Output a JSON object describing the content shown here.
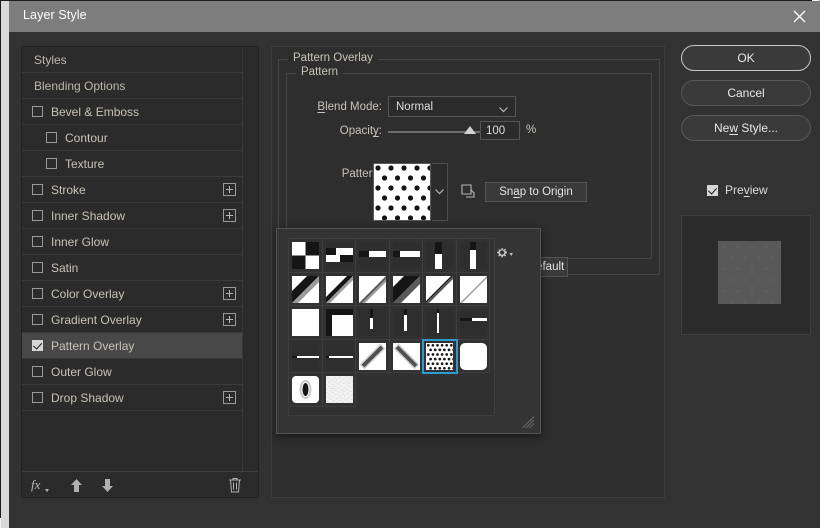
{
  "window": {
    "title": "Layer Style",
    "close_icon": "close-icon"
  },
  "styles_panel": {
    "rows": [
      {
        "label": "Styles",
        "type": "header",
        "checked": false,
        "plus": false,
        "selected": false
      },
      {
        "label": "Blending Options",
        "type": "header",
        "checked": false,
        "plus": false,
        "selected": false
      },
      {
        "label": "Bevel & Emboss",
        "type": "item",
        "checked": false,
        "plus": false,
        "selected": false
      },
      {
        "label": "Contour",
        "type": "sub",
        "checked": false,
        "plus": false,
        "selected": false
      },
      {
        "label": "Texture",
        "type": "sub",
        "checked": false,
        "plus": false,
        "selected": false
      },
      {
        "label": "Stroke",
        "type": "item",
        "checked": false,
        "plus": true,
        "selected": false
      },
      {
        "label": "Inner Shadow",
        "type": "item",
        "checked": false,
        "plus": true,
        "selected": false
      },
      {
        "label": "Inner Glow",
        "type": "item",
        "checked": false,
        "plus": false,
        "selected": false
      },
      {
        "label": "Satin",
        "type": "item",
        "checked": false,
        "plus": false,
        "selected": false
      },
      {
        "label": "Color Overlay",
        "type": "item",
        "checked": false,
        "plus": true,
        "selected": false
      },
      {
        "label": "Gradient Overlay",
        "type": "item",
        "checked": false,
        "plus": true,
        "selected": false
      },
      {
        "label": "Pattern Overlay",
        "type": "item",
        "checked": true,
        "plus": false,
        "selected": true
      },
      {
        "label": "Outer Glow",
        "type": "item",
        "checked": false,
        "plus": false,
        "selected": false
      },
      {
        "label": "Drop Shadow",
        "type": "item",
        "checked": false,
        "plus": true,
        "selected": false
      }
    ],
    "toolbar": {
      "fx_label": "fx",
      "fx_icon": "fx-menu-icon",
      "move_up_icon": "arrow-up-icon",
      "move_down_icon": "arrow-down-icon",
      "delete_icon": "trash-icon"
    }
  },
  "pattern_overlay": {
    "group_title": "Pattern Overlay",
    "inner_group_title": "Pattern",
    "blend_mode_label": "Blend Mode:",
    "blend_mode_value": "Normal",
    "opacity_label": "Opacity:",
    "opacity_value": "100",
    "opacity_unit": "%",
    "pattern_label": "Pattern:",
    "new_preset_icon": "new-preset-icon",
    "snap_button": "Snap to Origin",
    "reset_button": "Reset to Default",
    "swatch_name": "pattern-swatch-polka-dots",
    "dropdown_icon": "chevron-down-icon"
  },
  "pattern_picker": {
    "gear_icon": "gear-icon",
    "resize_grip_icon": "resize-grip-icon",
    "selected_index": 22,
    "columns": 6,
    "patterns": [
      {
        "name": "checkerboard-2x2",
        "kind": "checker"
      },
      {
        "name": "checkerboard-offset",
        "kind": "checker-small"
      },
      {
        "name": "dashes-horizontal",
        "kind": "dash-h-1"
      },
      {
        "name": "dashes-horizontal-2",
        "kind": "dash-h-2"
      },
      {
        "name": "bar-vertical-offset",
        "kind": "bar-v-1"
      },
      {
        "name": "bar-vertical-center",
        "kind": "bar-v-2"
      },
      {
        "name": "diagonal-thick-dark",
        "kind": "diag-1"
      },
      {
        "name": "diagonal-medium",
        "kind": "diag-2"
      },
      {
        "name": "diagonal-light",
        "kind": "diag-3"
      },
      {
        "name": "diagonal-double-dark",
        "kind": "diag-4"
      },
      {
        "name": "diagonal-thin-dark",
        "kind": "diag-5"
      },
      {
        "name": "diagonal-faint",
        "kind": "diag-6"
      },
      {
        "name": "plain-white",
        "kind": "plain"
      },
      {
        "name": "corner-frame-dark",
        "kind": "corner"
      },
      {
        "name": "line-vertical-short",
        "kind": "vline-1"
      },
      {
        "name": "line-vertical-mid",
        "kind": "vline-2"
      },
      {
        "name": "line-vertical-long",
        "kind": "vline-3"
      },
      {
        "name": "line-horizontal-split",
        "kind": "hsplit-1"
      },
      {
        "name": "line-horizontal-low",
        "kind": "hsplit-2"
      },
      {
        "name": "line-horizontal-low-2",
        "kind": "hsplit-3"
      },
      {
        "name": "diagonal-stroke-up",
        "kind": "stroke-up"
      },
      {
        "name": "diagonal-stroke-down",
        "kind": "stroke-down"
      },
      {
        "name": "polka-dots",
        "kind": "dots"
      },
      {
        "name": "rounded-blank",
        "kind": "rounded"
      },
      {
        "name": "ellipse-dark",
        "kind": "ellipse"
      },
      {
        "name": "noise-grain",
        "kind": "noise"
      }
    ]
  },
  "buttons": {
    "ok": "OK",
    "cancel": "Cancel",
    "new_style": "New Style...",
    "preview_label": "Preview",
    "preview_checked": true
  },
  "colors": {
    "dialog_bg": "#323232",
    "titlebar_bg": "#7d7d7d",
    "accent_selection": "#2f9ad0",
    "text": "#c8c3b8",
    "panel_bg": "#2b2b2b"
  }
}
